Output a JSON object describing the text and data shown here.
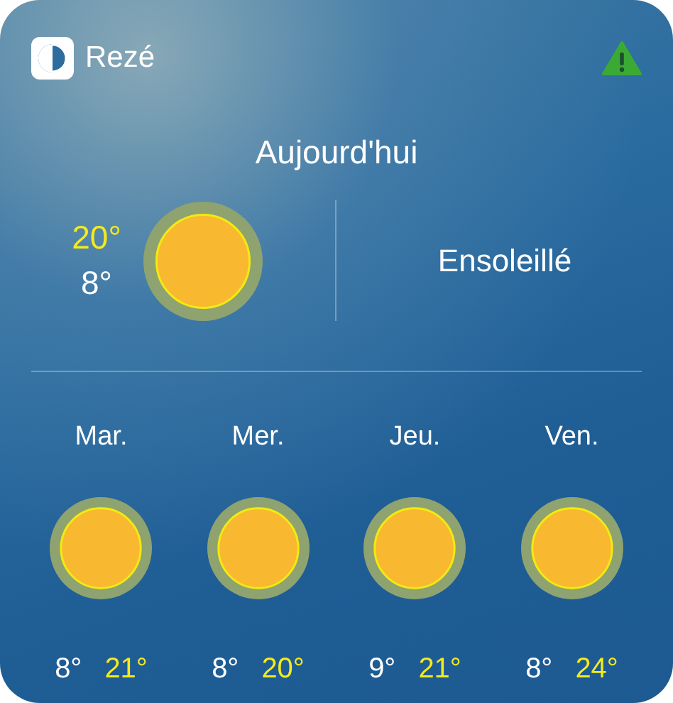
{
  "location": "Rezé",
  "today": {
    "title": "Aujourd'hui",
    "high": "20°",
    "low": "8°",
    "condition": "Ensoleillé"
  },
  "forecast": [
    {
      "day": "Mar.",
      "low": "8°",
      "high": "21°"
    },
    {
      "day": "Mer.",
      "low": "8°",
      "high": "20°"
    },
    {
      "day": "Jeu.",
      "low": "9°",
      "high": "21°"
    },
    {
      "day": "Ven.",
      "low": "8°",
      "high": "24°"
    }
  ]
}
